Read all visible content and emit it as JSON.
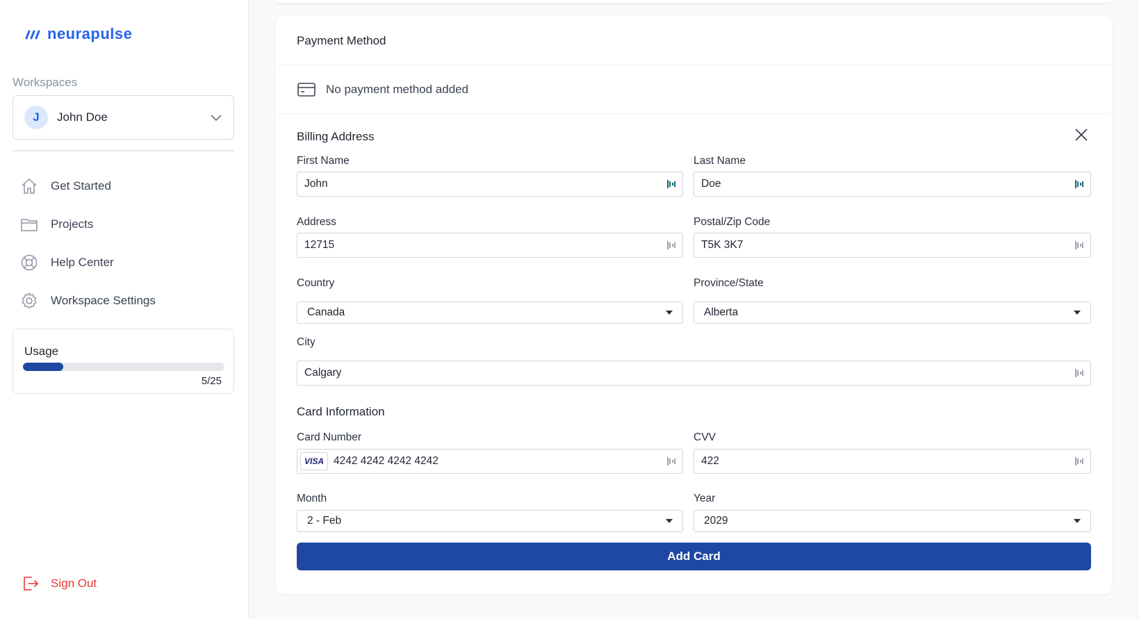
{
  "brand": {
    "name": "neurapulse",
    "color": "#2563eb"
  },
  "sidebar": {
    "workspaces_label": "Workspaces",
    "workspace": {
      "initial": "J",
      "name": "John Doe"
    },
    "nav": [
      {
        "label": "Get Started",
        "icon": "home-icon"
      },
      {
        "label": "Projects",
        "icon": "folder-icon"
      },
      {
        "label": "Help Center",
        "icon": "lifebuoy-icon"
      },
      {
        "label": "Workspace Settings",
        "icon": "gear-icon"
      }
    ],
    "usage": {
      "title": "Usage",
      "count": "5/25",
      "fraction": 0.2
    },
    "sign_out": "Sign Out"
  },
  "payment": {
    "title": "Payment Method",
    "empty_text": "No payment method added"
  },
  "billing": {
    "title": "Billing Address",
    "first_name": {
      "label": "First Name",
      "value": "John"
    },
    "last_name": {
      "label": "Last Name",
      "value": "Doe"
    },
    "address": {
      "label": "Address",
      "value": "12715"
    },
    "postal": {
      "label": "Postal/Zip Code",
      "value": "T5K 3K7"
    },
    "country": {
      "label": "Country",
      "value": "Canada"
    },
    "province": {
      "label": "Province/State",
      "value": "Alberta"
    },
    "city": {
      "label": "City",
      "value": "Calgary"
    }
  },
  "card": {
    "title": "Card Information",
    "number": {
      "label": "Card Number",
      "value": "4242 4242 4242 4242",
      "brand": "VISA"
    },
    "cvv": {
      "label": "CVV",
      "value": "422"
    },
    "month": {
      "label": "Month",
      "value": "2 - Feb"
    },
    "year": {
      "label": "Year",
      "value": "2029"
    },
    "submit": "Add Card"
  },
  "colors": {
    "primary": "#1e48a1",
    "danger": "#e53935",
    "muted": "#8a93a3"
  }
}
